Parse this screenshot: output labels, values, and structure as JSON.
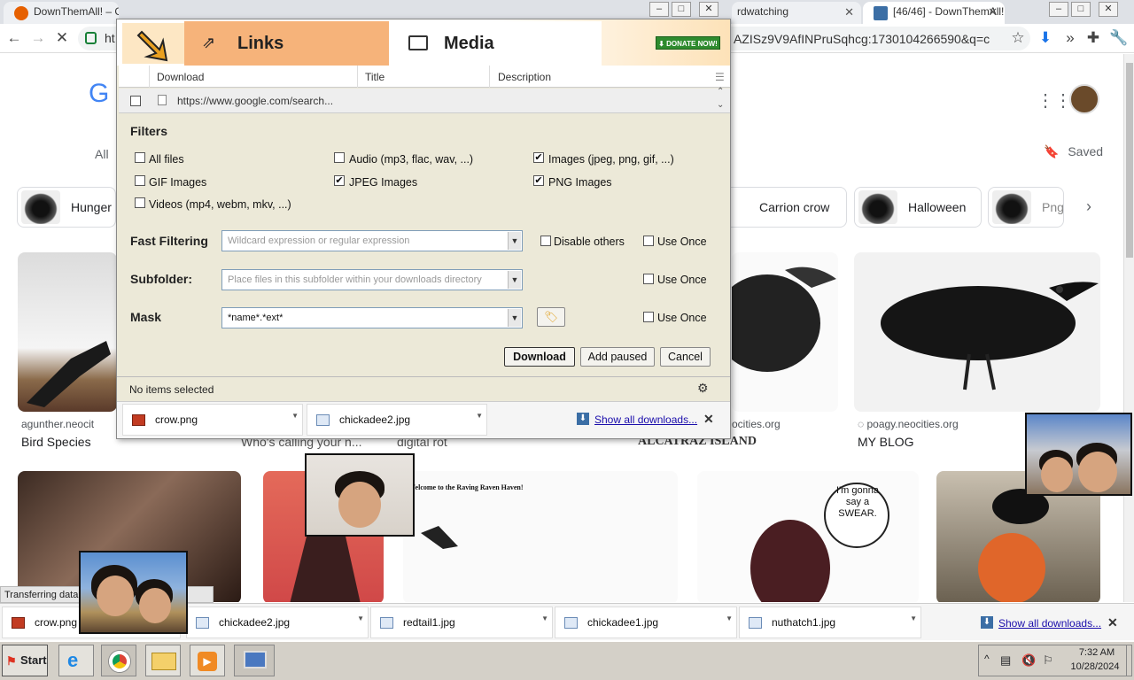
{
  "browser": {
    "tabs": [
      {
        "title": "DownThemAll! – Ge",
        "active": false
      },
      {
        "title": "rdwatching",
        "active": false
      },
      {
        "title": "[46/46] - DownThemAll!",
        "active": true
      }
    ],
    "address_prefix": "ht",
    "address_suffix": "AZISz9V9AfINPruSqhcg:1730104266590&q=c"
  },
  "google": {
    "logo_letter": "G",
    "nav_all": "All",
    "saved_label": "Saved",
    "chips": [
      "Hunger",
      "Carrion crow",
      "Halloween",
      "Png"
    ],
    "results": [
      {
        "source": "agunther.neocit",
        "caption": "Bird Species"
      },
      {
        "source": "",
        "caption": "Who's calling your n..."
      },
      {
        "source": "",
        "caption": "digital rot"
      },
      {
        "source": "",
        "caption": "ALCATRAZ ISLAND"
      },
      {
        "source": "ocities.org",
        "caption": ""
      },
      {
        "source": "poagy.neocities.org",
        "caption": "MY BLOG"
      }
    ],
    "raven_page_heading": "Welcome to the Raving Raven Haven!",
    "comic_bubble": "I'm gonna say a SWEAR."
  },
  "dta": {
    "tabs": {
      "links": "Links",
      "media": "Media"
    },
    "donate": "DONATE NOW!",
    "columns": {
      "download": "Download",
      "title": "Title",
      "description": "Description"
    },
    "row_url": "https://www.google.com/search...",
    "filters_title": "Filters",
    "filters": [
      {
        "label": "All files",
        "checked": false
      },
      {
        "label": "Audio (mp3, flac, wav, ...)",
        "checked": false
      },
      {
        "label": "Images (jpeg, png, gif, ...)",
        "checked": true
      },
      {
        "label": "GIF Images",
        "checked": false
      },
      {
        "label": "JPEG Images",
        "checked": true
      },
      {
        "label": "PNG Images",
        "checked": true
      },
      {
        "label": "Videos (mp4, webm, mkv, ...)",
        "checked": false
      }
    ],
    "fast_filtering": {
      "label": "Fast Filtering",
      "placeholder": "Wildcard expression or regular expression",
      "disable_others": "Disable others",
      "use_once": "Use Once"
    },
    "subfolder": {
      "label": "Subfolder:",
      "placeholder": "Place files in this subfolder within your downloads directory",
      "use_once": "Use Once"
    },
    "mask": {
      "label": "Mask",
      "value": "*name*.*ext*",
      "use_once": "Use Once"
    },
    "buttons": {
      "download": "Download",
      "add_paused": "Add paused",
      "cancel": "Cancel"
    },
    "status": "No items selected",
    "downloads": [
      "crow.png",
      "chickadee2.jpg"
    ],
    "show_all": "Show all downloads..."
  },
  "download_bar": {
    "status_text": "Transferring data",
    "items": [
      "crow.png",
      "chickadee2.jpg",
      "redtail1.jpg",
      "chickadee1.jpg",
      "nuthatch1.jpg"
    ],
    "show_all": "Show all downloads..."
  },
  "taskbar": {
    "start": "Start",
    "time": "7:32 AM",
    "date": "10/28/2024"
  }
}
